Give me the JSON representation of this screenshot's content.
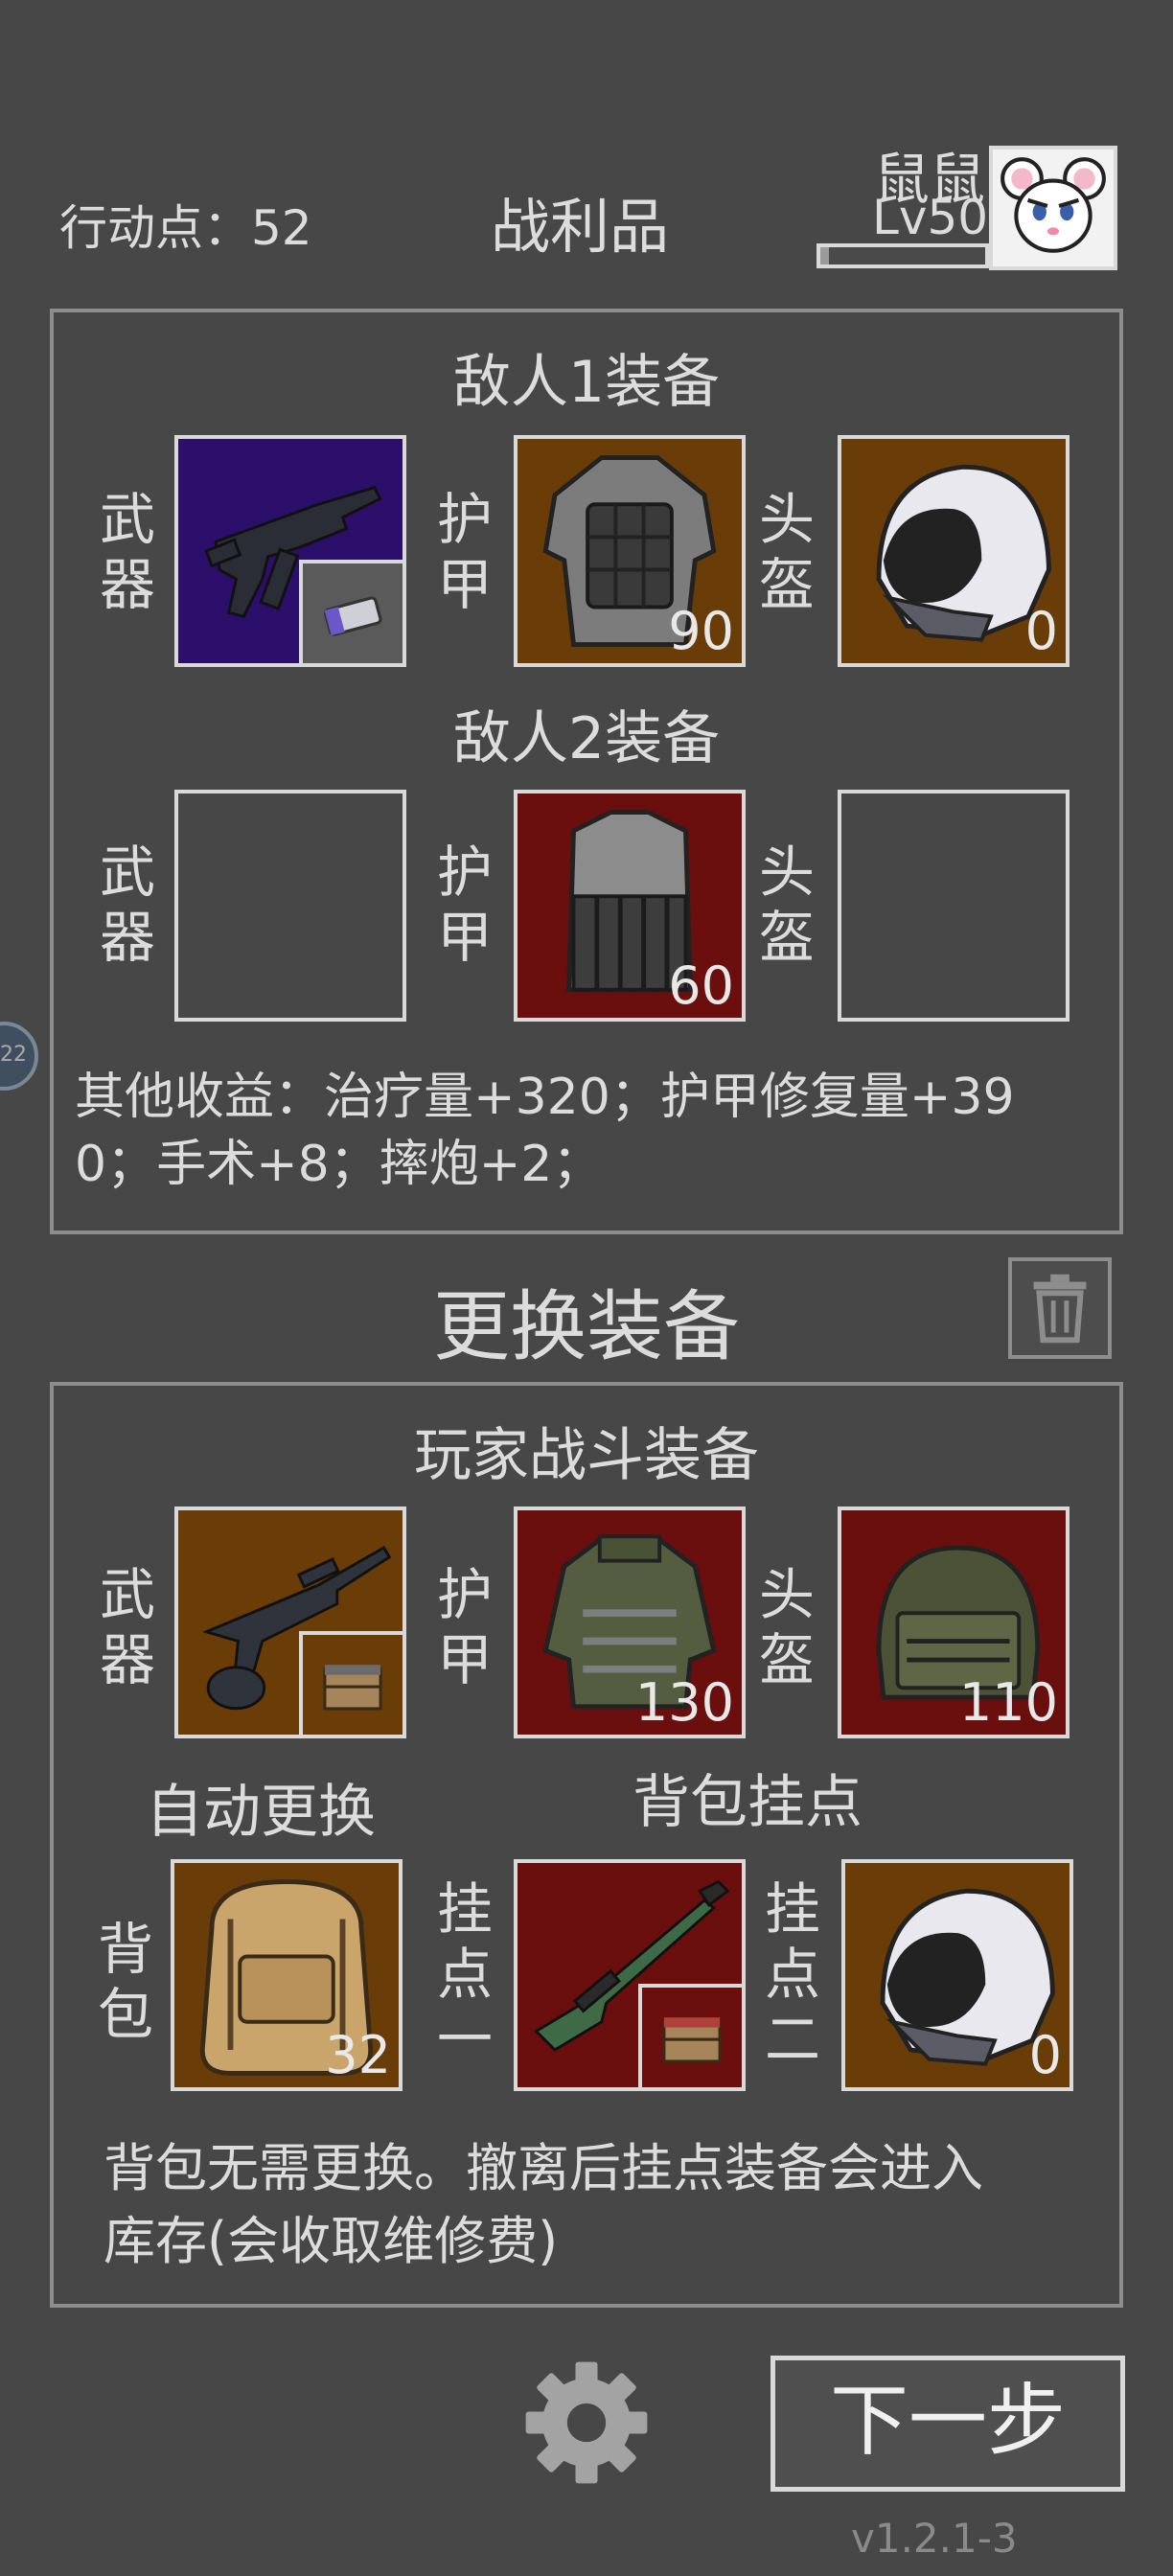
{
  "header": {
    "action_points_label": "行动点：52",
    "title": "战利品",
    "player_name": "鼠鼠",
    "player_level": "Lv50",
    "xp_progress": 0.05
  },
  "side_badge": "22",
  "loot": {
    "enemy1": {
      "title": "敌人1装备",
      "weapon_label": "武器",
      "armor_label": "护甲",
      "helmet_label": "头盔",
      "weapon_bg": "#2b0f6b",
      "armor_bg": "#6a3c08",
      "helmet_bg": "#6a3c08",
      "armor_value": "90",
      "helmet_value": "0"
    },
    "enemy2": {
      "title": "敌人2装备",
      "weapon_label": "武器",
      "armor_label": "护甲",
      "helmet_label": "头盔",
      "armor_bg": "#6a0e0e",
      "armor_value": "60"
    },
    "other_gains_line1": "其他收益：治疗量+320；护甲修复量+39",
    "other_gains_line2": "0；手术+8；摔炮+2；"
  },
  "change_equipment": {
    "title": "更换装备",
    "trash_icon": "trash-icon"
  },
  "player": {
    "title": "玩家战斗装备",
    "weapon_label": "武器",
    "armor_label": "护甲",
    "helmet_label": "头盔",
    "weapon_bg": "#6a3c08",
    "armor_bg": "#6a0e0e",
    "helmet_bg": "#6a0e0e",
    "armor_value": "130",
    "helmet_value": "110",
    "auto_replace": "自动更换",
    "backpack_mounts": "背包挂点",
    "backpack_label": "背包",
    "mount1_label": "挂点一",
    "mount2_label": "挂点二",
    "backpack_bg": "#6a3c08",
    "mount1_bg": "#6a0e0e",
    "mount2_bg": "#6a3c08",
    "backpack_value": "32",
    "mount2_value": "0",
    "note_line1": "背包无需更换。撤离后挂点装备会进入",
    "note_line2": "库存(会收取维修费)"
  },
  "footer": {
    "next_button": "下一步",
    "version": "v1.2.1-3",
    "settings_icon": "gear-icon"
  }
}
